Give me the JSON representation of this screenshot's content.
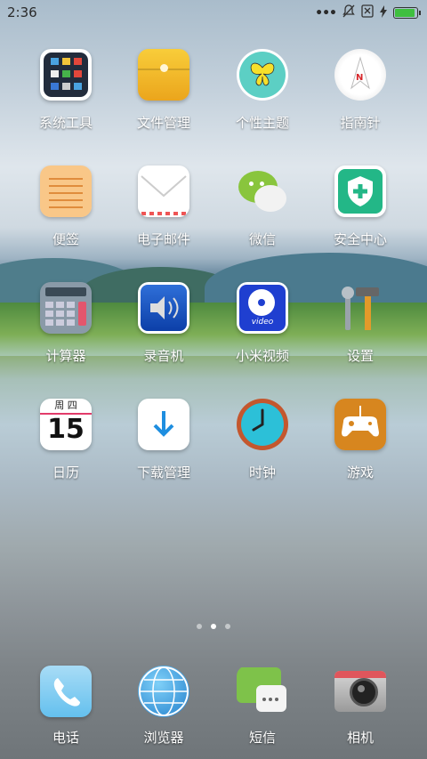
{
  "status_bar": {
    "time": "2:36",
    "icons": [
      "more-dots-icon",
      "mute-bell-icon",
      "no-sim-icon",
      "charging-bolt-icon",
      "battery-icon"
    ],
    "battery_level": 1.0
  },
  "apps": [
    {
      "label": "系统工具",
      "icon": "system-tools-folder-icon"
    },
    {
      "label": "文件管理",
      "icon": "file-manager-icon"
    },
    {
      "label": "个性主题",
      "icon": "themes-butterfly-icon"
    },
    {
      "label": "指南针",
      "icon": "compass-icon"
    },
    {
      "label": "便签",
      "icon": "notes-icon"
    },
    {
      "label": "电子邮件",
      "icon": "email-envelope-icon"
    },
    {
      "label": "微信",
      "icon": "wechat-icon"
    },
    {
      "label": "安全中心",
      "icon": "security-shield-icon"
    },
    {
      "label": "计算器",
      "icon": "calculator-icon"
    },
    {
      "label": "录音机",
      "icon": "recorder-speaker-icon"
    },
    {
      "label": "小米视频",
      "icon": "video-reel-icon"
    },
    {
      "label": "设置",
      "icon": "settings-tools-icon"
    },
    {
      "label": "日历",
      "icon": "calendar-icon",
      "calendar_weekday": "周 四",
      "calendar_day": "15"
    },
    {
      "label": "下载管理",
      "icon": "download-arrow-icon"
    },
    {
      "label": "时钟",
      "icon": "clock-icon"
    },
    {
      "label": "游戏",
      "icon": "gamepad-icon"
    }
  ],
  "video_icon_text": "video",
  "compass_letter": "N",
  "page_indicator": {
    "count": 3,
    "active": 2
  },
  "dock": [
    {
      "label": "电话",
      "icon": "phone-icon"
    },
    {
      "label": "浏览器",
      "icon": "browser-globe-icon"
    },
    {
      "label": "短信",
      "icon": "messages-bubble-icon"
    },
    {
      "label": "相机",
      "icon": "camera-icon"
    }
  ]
}
